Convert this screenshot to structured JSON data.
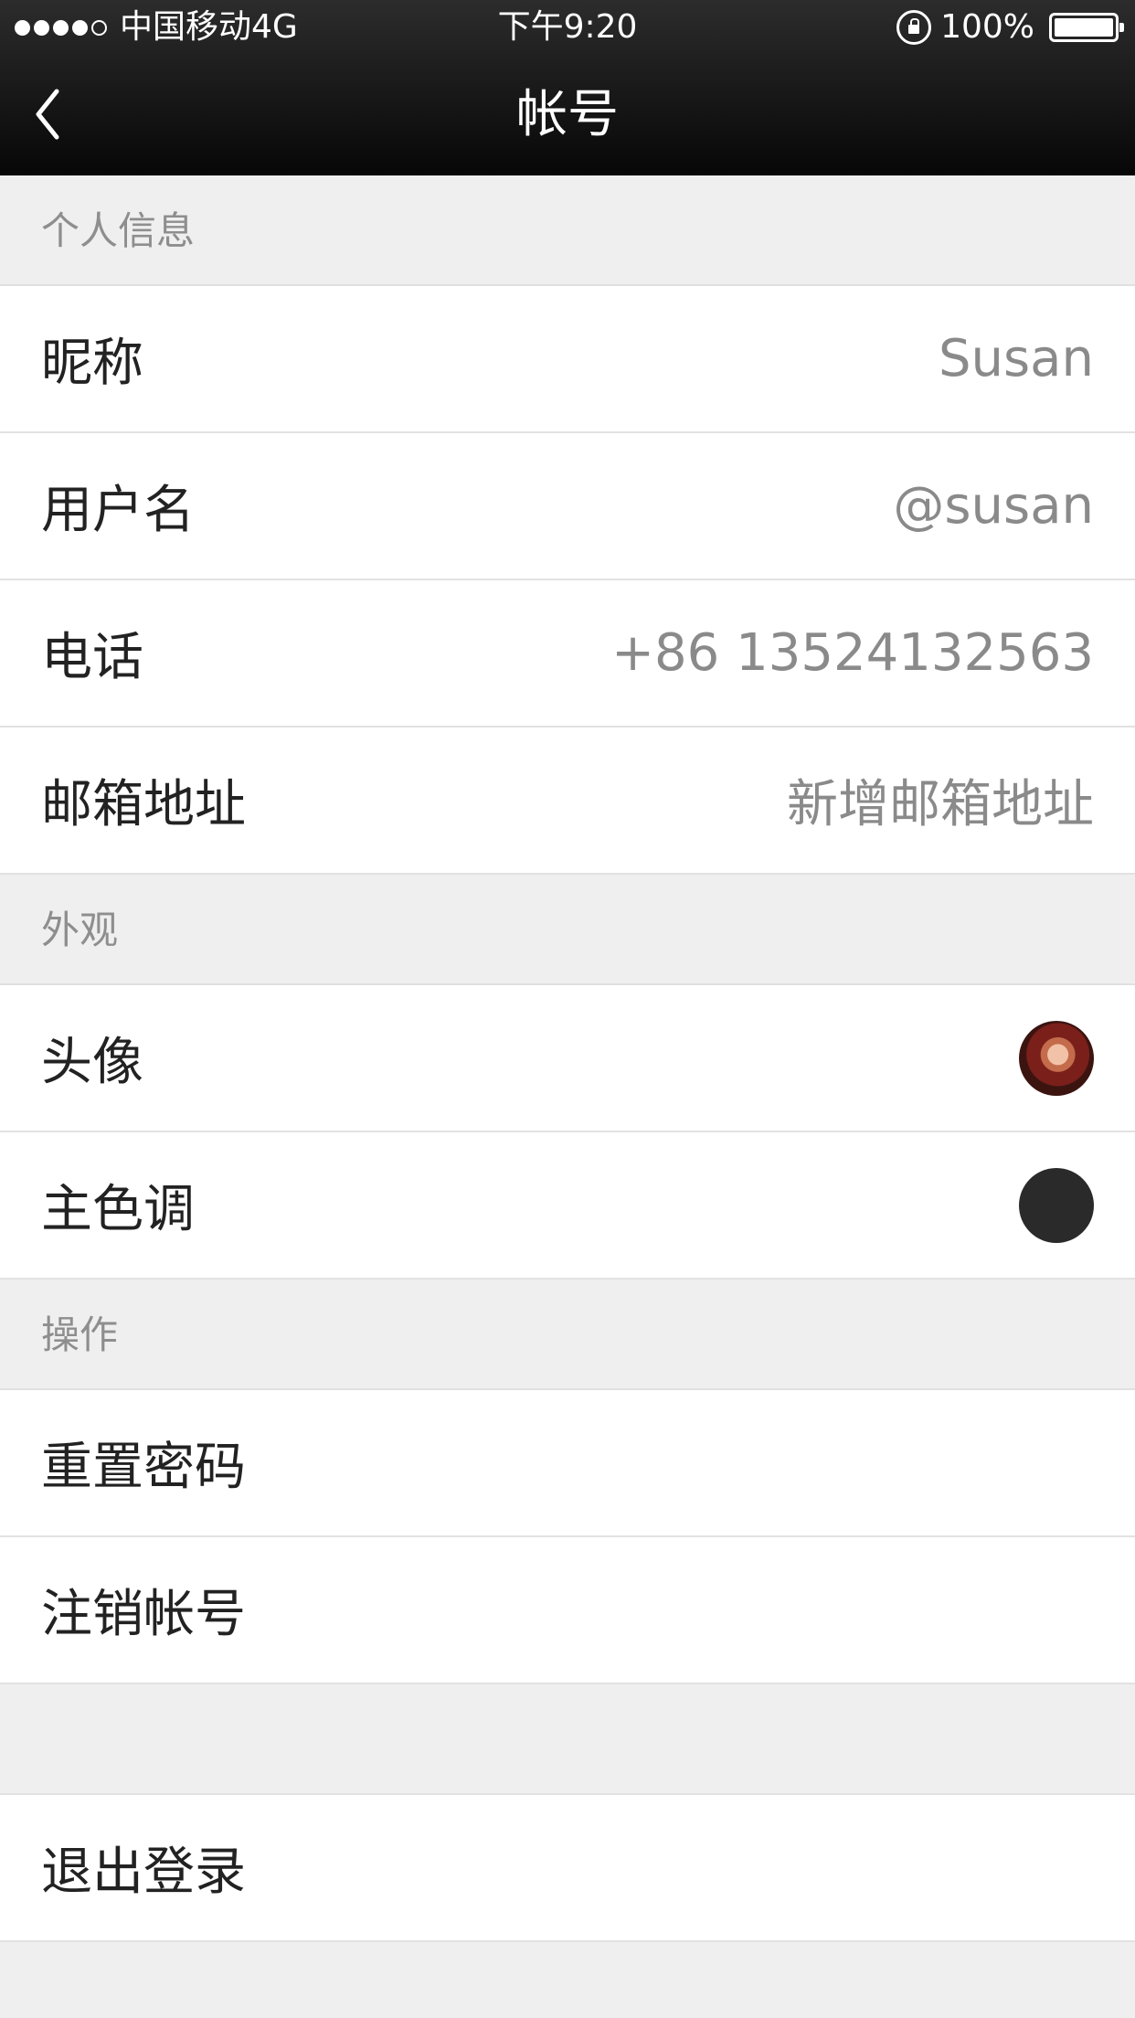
{
  "status_bar": {
    "carrier": "中国移动4G",
    "time": "下午9:20",
    "battery": "100%"
  },
  "nav": {
    "title": "帐号"
  },
  "sections": {
    "personal": {
      "header": "个人信息",
      "nickname_label": "昵称",
      "nickname_value": "Susan",
      "username_label": "用户名",
      "username_value": "@susan",
      "phone_label": "电话",
      "phone_value": "+86 13524132563",
      "email_label": "邮箱地址",
      "email_value": "新增邮箱地址"
    },
    "appearance": {
      "header": "外观",
      "avatar_label": "头像",
      "theme_label": "主色调",
      "theme_color": "#2a2a2a"
    },
    "actions": {
      "header": "操作",
      "reset_password": "重置密码",
      "delete_account": "注销帐号"
    },
    "logout": {
      "label": "退出登录"
    }
  },
  "colors": {
    "navbar_bg": "#0a0a0a",
    "page_bg": "#efefef",
    "section_text": "#8e8e8e",
    "label_text": "#222222",
    "value_text": "#8a8a8a"
  }
}
